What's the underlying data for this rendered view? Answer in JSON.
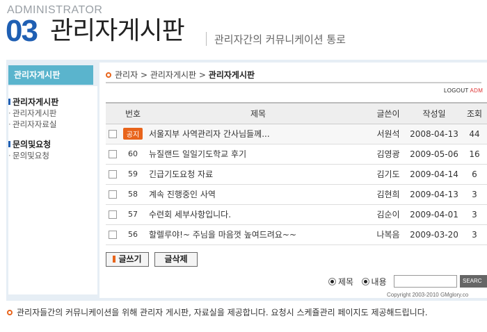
{
  "header": {
    "admin": "ADMINISTRATOR",
    "number": "03",
    "title": "관리자게시판",
    "subtitle": "관리자간의 커뮤니케이션 통로"
  },
  "sidebar": {
    "heading": "관리자게시판",
    "groups": [
      {
        "title": "관리자게시판",
        "links": [
          "관리자게시판",
          "관리자자료실"
        ]
      },
      {
        "title": "문의및요청",
        "links": [
          "문의및요청"
        ]
      }
    ]
  },
  "breadcrumb": {
    "home": "관리자",
    "section": "관리자게시판",
    "current": "관리자게시판"
  },
  "logout": {
    "label": "LOGOUT",
    "admin": "ADM"
  },
  "table": {
    "columns": [
      "번호",
      "제목",
      "글쓴이",
      "작성일",
      "조회"
    ],
    "rows": [
      {
        "num": "",
        "badge": "공지",
        "subject": "서울지부 사역관리자 간사님들께...",
        "author": "서원석",
        "date": "2008-04-13",
        "views": "44"
      },
      {
        "num": "60",
        "subject": "뉴질랜드 일일기도학교 후기",
        "author": "김영광",
        "date": "2009-05-06",
        "views": "16"
      },
      {
        "num": "59",
        "subject": "긴급기도요청 자료",
        "author": "김기도",
        "date": "2009-04-14",
        "views": "6"
      },
      {
        "num": "58",
        "subject": "계속 진행중인 사역",
        "author": "김현희",
        "date": "2009-04-13",
        "views": "3"
      },
      {
        "num": "57",
        "subject": "수련회 세부사항입니다.",
        "author": "김순이",
        "date": "2009-04-01",
        "views": "3"
      },
      {
        "num": "56",
        "subject": "할렐루야!~   주님을 마음껏 높여드려요~~",
        "author": "나복음",
        "date": "2009-03-20",
        "views": "3"
      }
    ]
  },
  "buttons": {
    "write": "글쓰기",
    "delete": "글삭제"
  },
  "search": {
    "opt_subject": "제목",
    "opt_content": "내용",
    "button": "SEARC",
    "value": ""
  },
  "copyright": "Copyright 2003-2010 GMglory.co",
  "footnote": "관리자들간의 커뮤니케이션을 위해 관리자 게시판, 자료실을 제공합니다. 요청시 스케쥴관리 페이지도 제공해드립니다."
}
